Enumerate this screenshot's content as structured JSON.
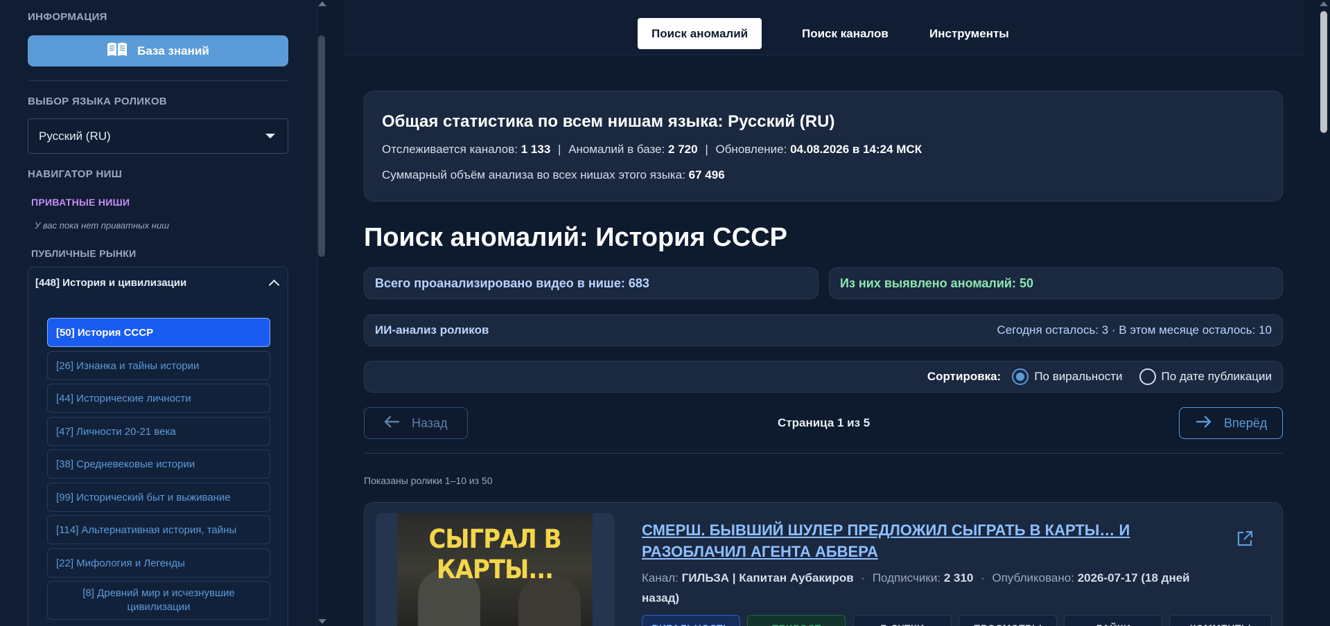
{
  "sidebar": {
    "info_heading": "ИНФОРМАЦИЯ",
    "kb_button": "База знаний",
    "lang_heading": "ВЫБОР ЯЗЫКА РОЛИКОВ",
    "lang_value": "Русский (RU)",
    "nav_heading": "НАВИГАТОР НИШ",
    "private_heading": "ПРИВАТНЫЕ НИШИ",
    "private_empty": "У вас пока нет приватных ниш",
    "public_heading": "ПУБЛИЧНЫЕ РЫНКИ",
    "group_title": "[448] История и цивилизации",
    "niches": [
      "[50] История СССР",
      "[26] Изнанка и тайны истории",
      "[44] Исторические личности",
      "[47] Личности 20-21 века",
      "[38] Средневековые истории",
      "[99] Исторический быт и выживание",
      "[114] Альтернативная история, тайны",
      "[22] Мифология и Легенды",
      "[8] Древний мир и исчезнувшие цивилизации"
    ]
  },
  "tabs": [
    "Поиск аномалий",
    "Поиск каналов",
    "Инструменты"
  ],
  "stats": {
    "title": "Общая статистика по всем нишам языка: Русский (RU)",
    "channels_label": "Отслеживается каналов:",
    "channels_value": "1 133",
    "anomalies_label": "Аномалий в базе:",
    "anomalies_value": "2 720",
    "update_label": "Обновление:",
    "update_value": "04.08.2026 в 14:24 МСК",
    "volume_label": "Суммарный объём анализа во всех нишах этого языка:",
    "volume_value": "67 496"
  },
  "page_title": "Поиск аномалий: История СССР",
  "analyzed": "Всего проанализировано видео в нише: 683",
  "found": "Из них выявлено аномалий: 50",
  "ai": {
    "label": "ИИ-анализ роликов",
    "quota": "Сегодня осталось: 3 · В этом месяце осталось: 10"
  },
  "sort": {
    "label": "Сортировка:",
    "option1": "По виральности",
    "option2": "По дате публикации"
  },
  "pager": {
    "prev": "Назад",
    "next": "Вперёд",
    "status": "Страница 1 из 5"
  },
  "shown": "Показаны ролики 1–10 из 50",
  "video": {
    "thumb_text": "СЫГРАЛ В КАРТЫ...",
    "title": "СМЕРШ. БЫВШИЙ ШУЛЕР ПРЕДЛОЖИЛ СЫГРАТЬ В КАРТЫ… И РАЗОБЛАЧИЛ АГЕНТА АБВЕРА",
    "channel_label": "Канал:",
    "channel_value": "ГИЛЬЗА | Капитан Аубакиров",
    "subs_label": "Подписчики:",
    "subs_value": "2 310",
    "published_label": "Опубликовано:",
    "published_value": "2026-07-17 (18 дней назад)",
    "badges": [
      "ВИРАЛЬНОСТЬ",
      "ПРИРОСТ",
      "В СУТКИ",
      "ПРОСМОТРЫ",
      "ЛАЙКИ",
      "КОММЕНТЫ"
    ]
  },
  "colors": {
    "accent": "#5b9bd8",
    "active_niche": "#1a5cf0",
    "private": "#c78cf5",
    "green": "#8ee6b0",
    "link": "#8ec0ff"
  }
}
